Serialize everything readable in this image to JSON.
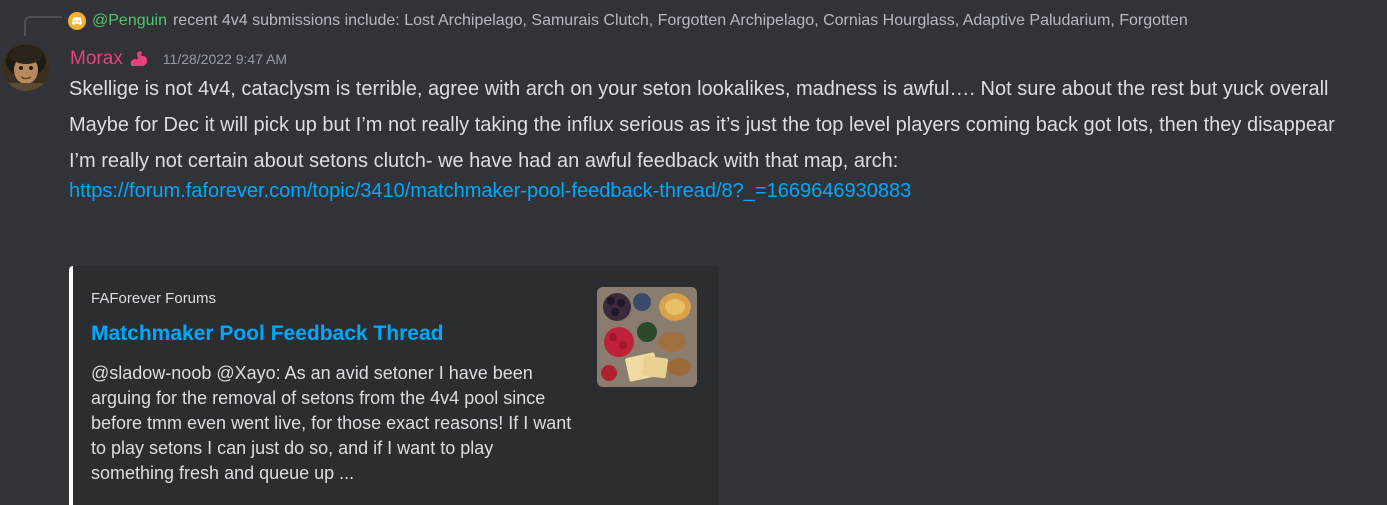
{
  "reply": {
    "author": "@Penguin",
    "text": "recent 4v4 submissions include: Lost Archipelago, Samurais Clutch, Forgotten Archipelago, Cornias Hourglass, Adaptive Paludarium, Forgotten",
    "avatar_icon": "discord-default-avatar-icon"
  },
  "message": {
    "author": "Morax",
    "author_color": "#e8417d",
    "role_icon": "flexed-biceps-icon",
    "timestamp": "11/28/2022 9:47 AM",
    "paragraphs": [
      "Skellige is not 4v4, cataclysm is terrible, agree with arch on your seton lookalikes, madness is awful…. Not sure about the rest but yuck overall",
      "Maybe for Dec it will pick up but I’m not really taking the influx serious as it’s just the top level players coming back got lots, then they disappear",
      "I’m really not certain about setons clutch- we have had an awful feedback with that map, arch:"
    ],
    "link": "https://forum.faforever.com/topic/3410/matchmaker-pool-feedback-thread/8?_=1669646930883"
  },
  "embed": {
    "provider": "FAForever Forums",
    "title": "Matchmaker Pool Feedback Thread",
    "description": "@sladow-noob @Xayo: As an avid setoner I have been arguing for the removal of setons from the 4v4 pool since before tmm even went live, for those exact reasons! If I want to play setons I can just do so, and if I want to play something fresh and queue up ...",
    "border_color": "#ffffff",
    "thumbnail": "food-platter-thumbnail"
  },
  "colors": {
    "background": "#313338",
    "link": "#00a8fc",
    "reply_author": "#52c46a"
  }
}
